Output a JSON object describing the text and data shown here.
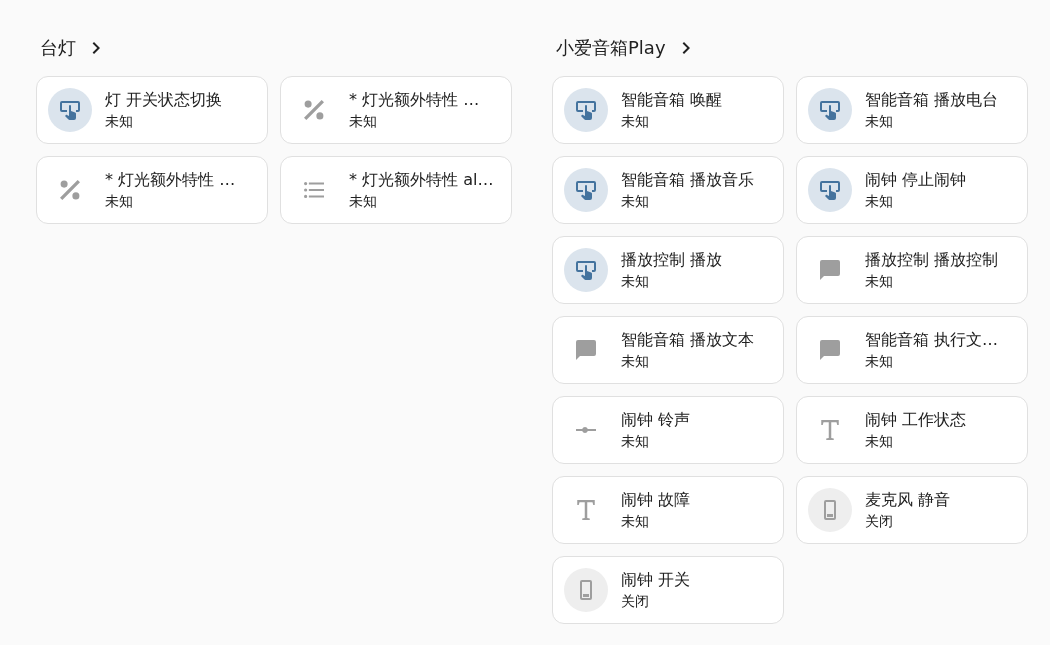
{
  "groups": [
    {
      "title": "台灯",
      "entities": [
        {
          "kind": "button",
          "name": "灯 开关状态切换",
          "state": "未知"
        },
        {
          "kind": "percent",
          "name": "* 灯光额外特性 …",
          "state": "未知"
        },
        {
          "kind": "percent",
          "name": "* 灯光额外特性 …",
          "state": "未知"
        },
        {
          "kind": "list",
          "name": "* 灯光额外特性 al…",
          "state": "未知"
        }
      ]
    },
    {
      "title": "小爱音箱Play",
      "entities": [
        {
          "kind": "button",
          "name": "智能音箱 唤醒",
          "state": "未知"
        },
        {
          "kind": "button",
          "name": "智能音箱 播放电台",
          "state": "未知"
        },
        {
          "kind": "button",
          "name": "智能音箱 播放音乐",
          "state": "未知"
        },
        {
          "kind": "button",
          "name": "闹钟 停止闹钟",
          "state": "未知"
        },
        {
          "kind": "button",
          "name": "播放控制 播放",
          "state": "未知"
        },
        {
          "kind": "message",
          "name": "播放控制 播放控制",
          "state": "未知"
        },
        {
          "kind": "message",
          "name": "智能音箱 播放文本",
          "state": "未知"
        },
        {
          "kind": "message",
          "name": "智能音箱 执行文…",
          "state": "未知"
        },
        {
          "kind": "slider",
          "name": "闹钟 铃声",
          "state": "未知"
        },
        {
          "kind": "text",
          "name": "闹钟 工作状态",
          "state": "未知"
        },
        {
          "kind": "text",
          "name": "闹钟 故障",
          "state": "未知"
        },
        {
          "kind": "toggle",
          "on": false,
          "name": "麦克风 静音",
          "state": "关闭"
        },
        {
          "kind": "toggle",
          "on": false,
          "name": "闹钟 开关",
          "state": "关闭"
        }
      ]
    }
  ]
}
